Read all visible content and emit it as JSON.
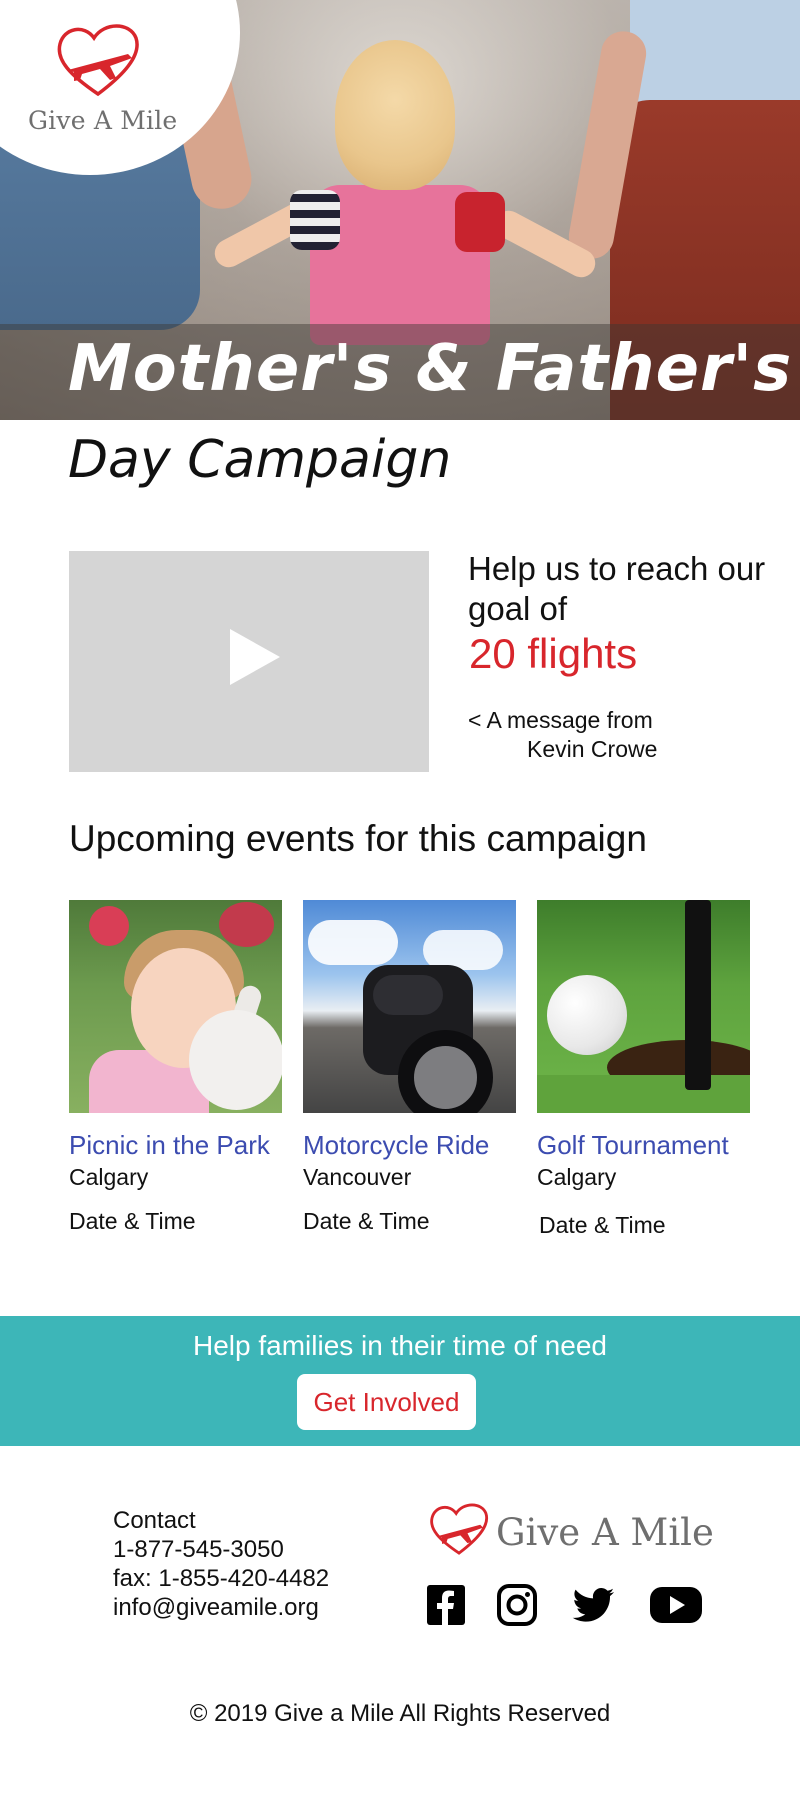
{
  "brand": {
    "name": "Give A Mile",
    "logo_heart_color": "#d8262c",
    "accent_teal": "#3db6b8",
    "link_blue": "#3c4cb0"
  },
  "hero": {
    "title_line1": "Mother's & Father's",
    "title_line2": "Day Campaign"
  },
  "goal": {
    "text": "Help us to reach our goal of",
    "value": "20 flights",
    "message_line1": "< A message from",
    "message_line2": "Kevin Crowe"
  },
  "events": {
    "heading": "Upcoming events for this campaign",
    "items": [
      {
        "title": "Picnic in the Park",
        "city": "Calgary",
        "date": "Date & Time",
        "image_icon": "picnic-photo"
      },
      {
        "title": "Motorcycle Ride",
        "city": "Vancouver",
        "date": "Date & Time",
        "image_icon": "motorcycle-photo"
      },
      {
        "title": "Golf Tournament",
        "city": "Calgary",
        "date": "Date & Time",
        "image_icon": "golf-photo"
      }
    ]
  },
  "cta": {
    "text": "Help families in their time of need",
    "button_label": "Get Involved"
  },
  "footer": {
    "contact_label": "Contact",
    "phone": "1-877-545-3050",
    "fax": "fax: 1-855-420-4482",
    "email": "info@giveamile.org",
    "social": [
      "facebook-icon",
      "instagram-icon",
      "twitter-icon",
      "youtube-icon"
    ],
    "copyright": "© 2019 Give a Mile All Rights Reserved"
  }
}
